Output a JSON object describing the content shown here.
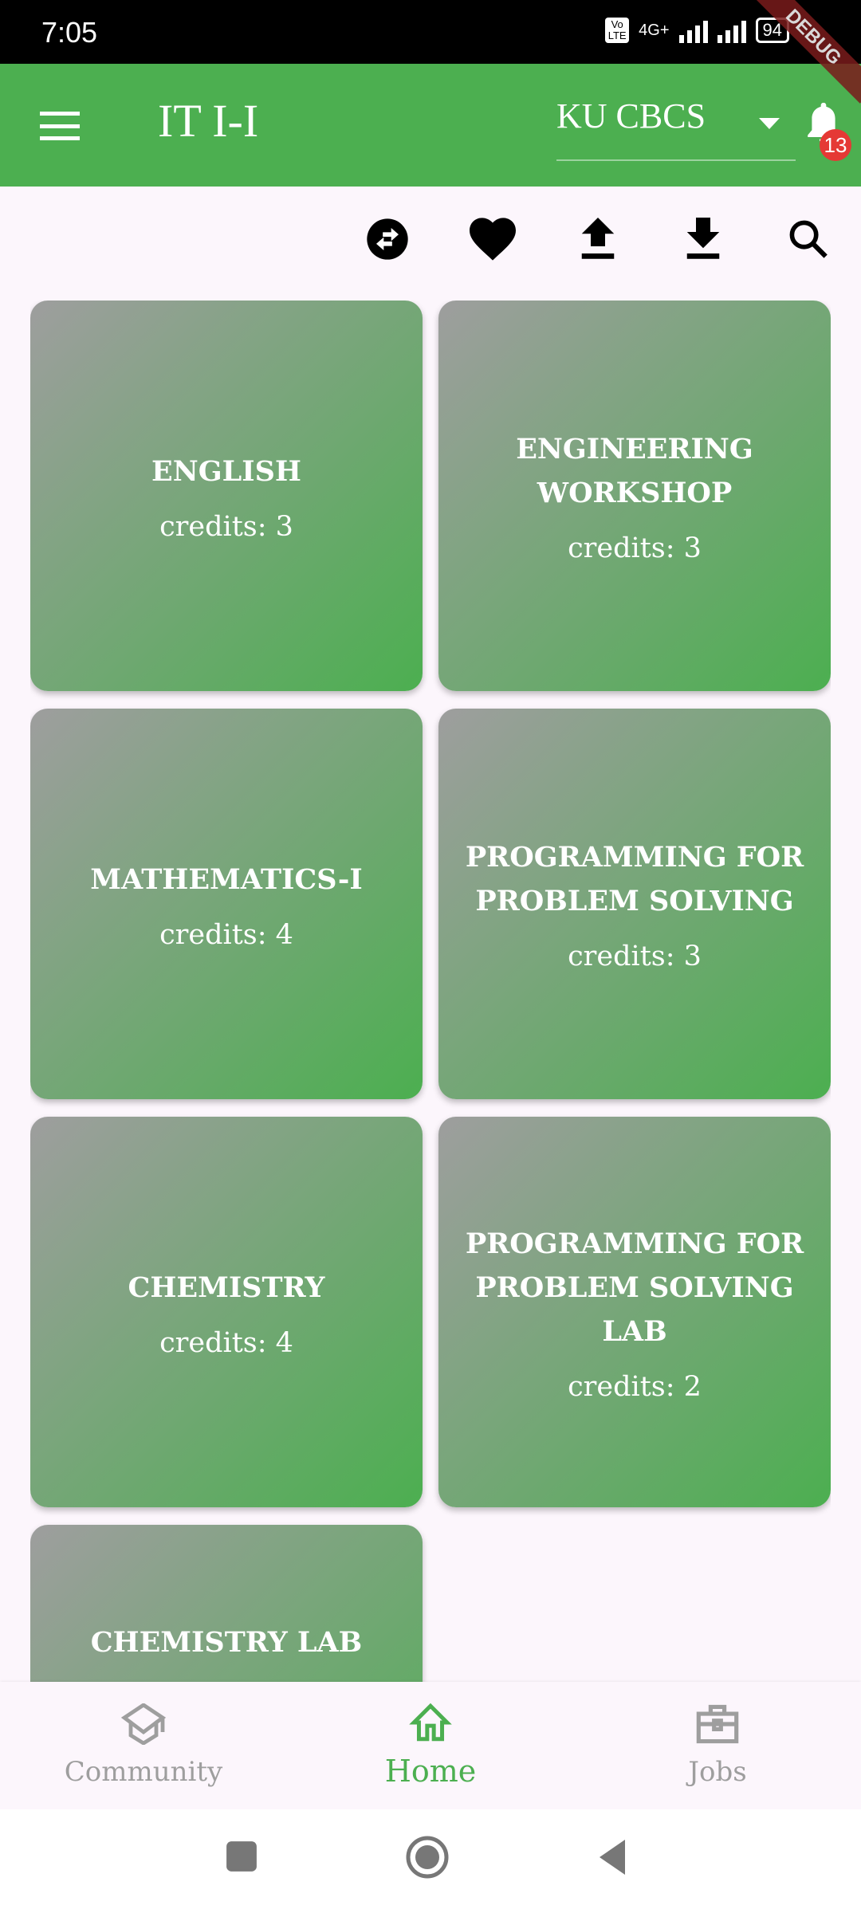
{
  "status_bar": {
    "time": "7:05",
    "network": "4G+",
    "volte": "Vo LTE",
    "battery": "94"
  },
  "debug_banner": "DEBUG",
  "app_bar": {
    "title": "IT I-I",
    "university_select": "KU CBCS",
    "notification_count": "13"
  },
  "toolbar": {
    "icons": [
      "swap-icon",
      "heart-icon",
      "upload-icon",
      "download-icon",
      "search-icon"
    ]
  },
  "subjects": [
    {
      "name": "ENGLISH",
      "credits": "credits: 3"
    },
    {
      "name": "ENGINEERING WORKSHOP",
      "credits": "credits: 3"
    },
    {
      "name": "MATHEMATICS-I",
      "credits": "credits: 4"
    },
    {
      "name": "PROGRAMMING FOR PROBLEM SOLVING",
      "credits": "credits: 3"
    },
    {
      "name": "CHEMISTRY",
      "credits": "credits: 4"
    },
    {
      "name": "PROGRAMMING FOR PROBLEM SOLVING LAB",
      "credits": "credits: 2"
    },
    {
      "name": "CHEMISTRY LAB",
      "credits": ""
    }
  ],
  "bottom_nav": {
    "items": [
      {
        "label": "Community",
        "icon": "graduation-cap-icon",
        "active": false
      },
      {
        "label": "Home",
        "icon": "home-icon",
        "active": true
      },
      {
        "label": "Jobs",
        "icon": "briefcase-icon",
        "active": false
      }
    ]
  },
  "colors": {
    "primary": "#4caf50",
    "inactive": "#9e9e9e",
    "badge": "#e53935",
    "background": "#fcf6fc"
  }
}
